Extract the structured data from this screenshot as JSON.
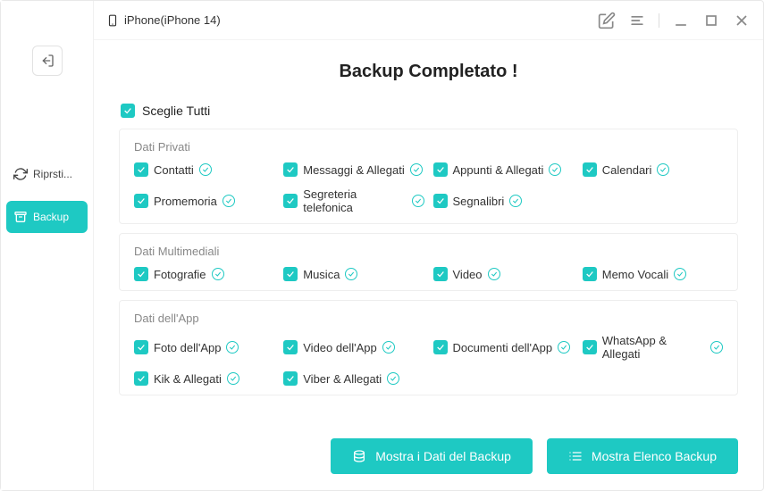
{
  "colors": {
    "accent": "#1ec9c3"
  },
  "titlebar": {
    "device": "iPhone(iPhone 14)"
  },
  "sidebar": {
    "items": [
      {
        "label": "Riprsti...",
        "icon": "refresh"
      },
      {
        "label": "Backup",
        "icon": "archive",
        "active": true
      }
    ]
  },
  "page": {
    "title": "Backup Completato !",
    "select_all_label": "Sceglie Tutti"
  },
  "sections": [
    {
      "title": "Dati Privati",
      "items": [
        {
          "label": "Contatti",
          "checked": true,
          "done": true
        },
        {
          "label": "Messaggi & Allegati",
          "checked": true,
          "done": true
        },
        {
          "label": "Appunti & Allegati",
          "checked": true,
          "done": true
        },
        {
          "label": "Calendari",
          "checked": true,
          "done": true
        },
        {
          "label": "Promemoria",
          "checked": true,
          "done": true
        },
        {
          "label": "Segreteria telefonica",
          "checked": true,
          "done": true
        },
        {
          "label": "Segnalibri",
          "checked": true,
          "done": true
        }
      ]
    },
    {
      "title": "Dati Multimediali",
      "items": [
        {
          "label": "Fotografie",
          "checked": true,
          "done": true
        },
        {
          "label": "Musica",
          "checked": true,
          "done": true
        },
        {
          "label": "Video",
          "checked": true,
          "done": true
        },
        {
          "label": "Memo Vocali",
          "checked": true,
          "done": true
        }
      ]
    },
    {
      "title": "Dati dell'App",
      "items": [
        {
          "label": "Foto dell'App",
          "checked": true,
          "done": true
        },
        {
          "label": "Video dell'App",
          "checked": true,
          "done": true
        },
        {
          "label": "Documenti dell'App",
          "checked": true,
          "done": true
        },
        {
          "label": "WhatsApp & Allegati",
          "checked": true,
          "done": true
        },
        {
          "label": "Kik & Allegati",
          "checked": true,
          "done": true
        },
        {
          "label": "Viber & Allegati",
          "checked": true,
          "done": true
        }
      ]
    }
  ],
  "footer": {
    "show_data": "Mostra i Dati del Backup",
    "show_list": "Mostra Elenco Backup"
  }
}
